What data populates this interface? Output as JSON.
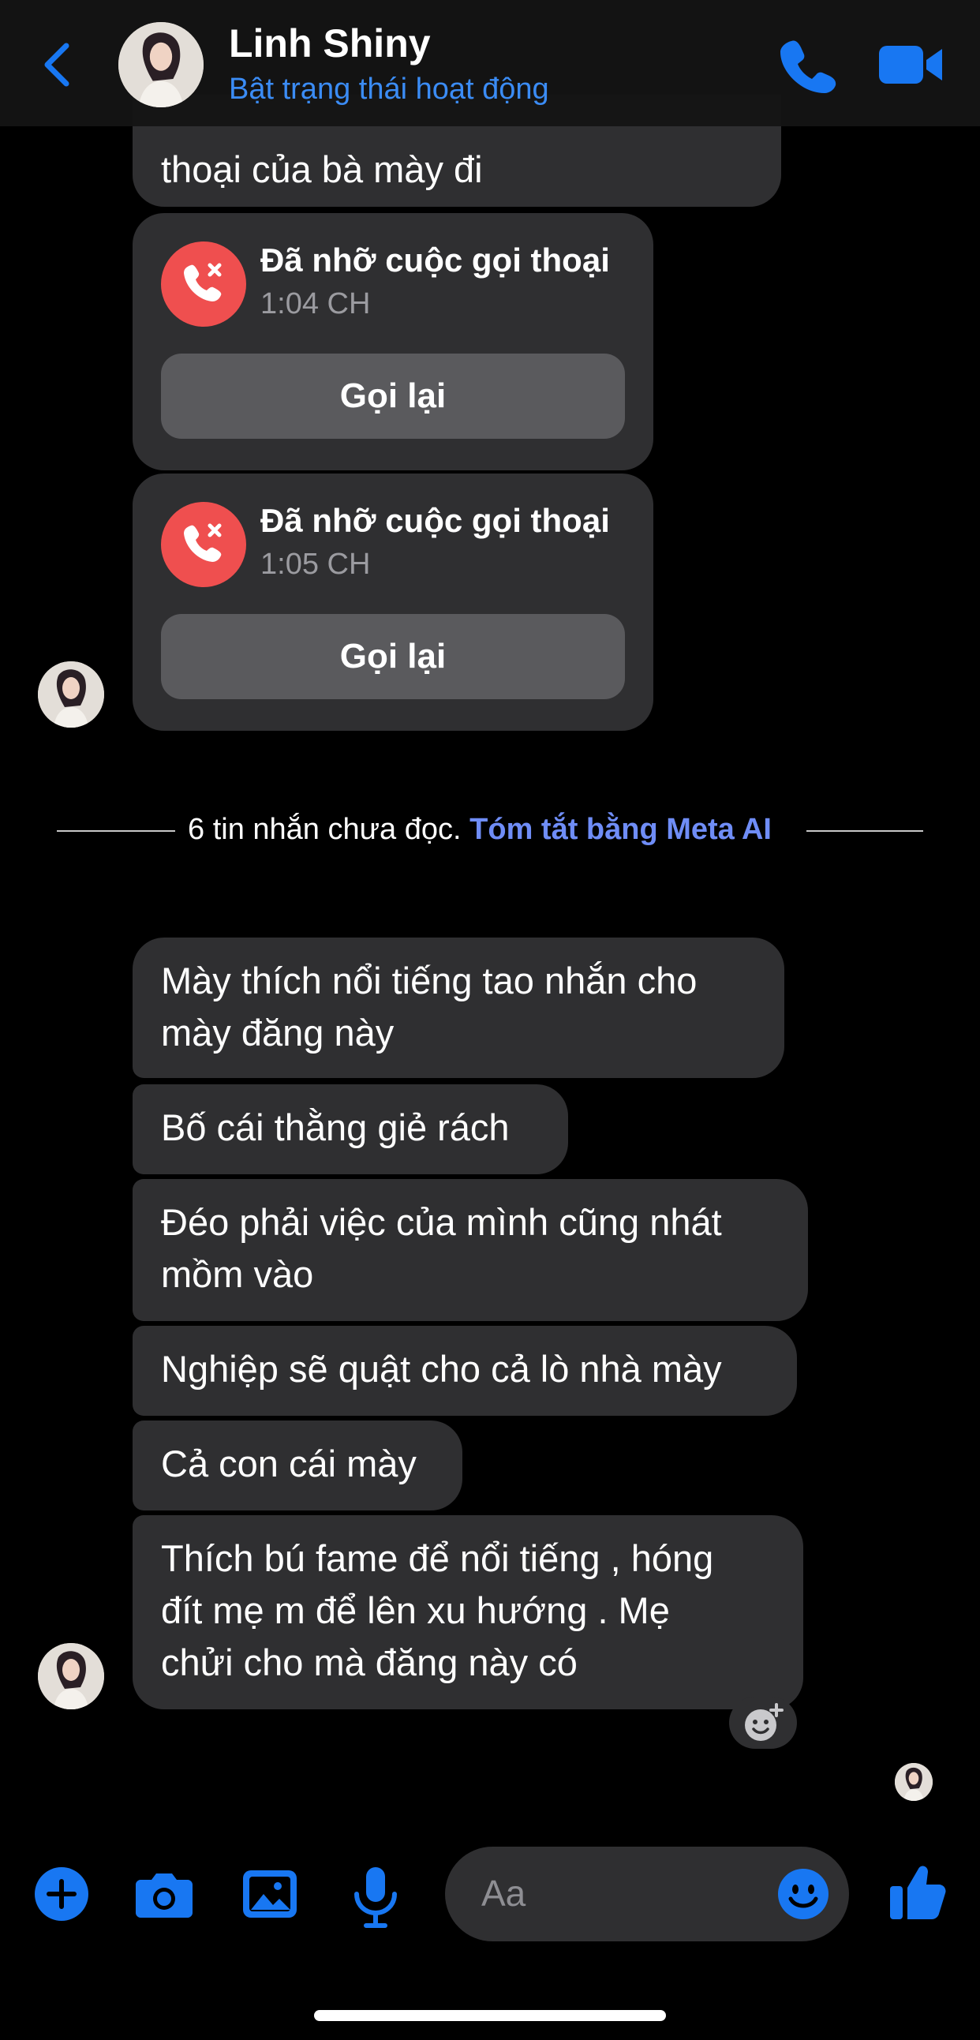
{
  "header": {
    "name": "Linh Shiny",
    "status": "Bật trạng thái hoạt động"
  },
  "messages": {
    "partial_top": "thoại của bà mày đi",
    "call_1": {
      "title": "Đã nhỡ cuộc gọi thoại",
      "time": "1:04 CH",
      "action": "Gọi lại"
    },
    "call_2": {
      "title": "Đã nhỡ cuộc gọi thoại",
      "time": "1:05 CH",
      "action": "Gọi lại"
    },
    "divider": {
      "text": "6 tin nhắn chưa đọc.",
      "link": "Tóm tắt bằng Meta AI"
    },
    "m1_l1": "Mày thích nổi tiếng tao nhắn cho",
    "m1_l2": "mày đăng này",
    "m2": "Bố cái thằng giẻ rách",
    "m3_l1": "Đéo phải việc của mình cũng nhát",
    "m3_l2": "mồm vào",
    "m4": "Nghiệp sẽ quật cho cả lò nhà mày",
    "m5": "Cả con cái mày",
    "m6_l1": "Thích bú fame để nổi tiếng , hóng",
    "m6_l2": "đít mẹ m để lên xu hướng . Mẹ",
    "m6_l3": "chửi cho mà đăng này có"
  },
  "composer": {
    "placeholder": "Aa"
  },
  "colors": {
    "accent": "#1877f2",
    "missed_call": "#ef4f4f",
    "bubble": "#2f2f31",
    "link": "#6f8df7"
  },
  "icons": [
    "back-icon",
    "phone-icon",
    "video-icon",
    "missed-call-icon",
    "add-icon",
    "camera-icon",
    "image-icon",
    "mic-icon",
    "emoji-icon",
    "like-icon",
    "add-reaction-icon"
  ]
}
